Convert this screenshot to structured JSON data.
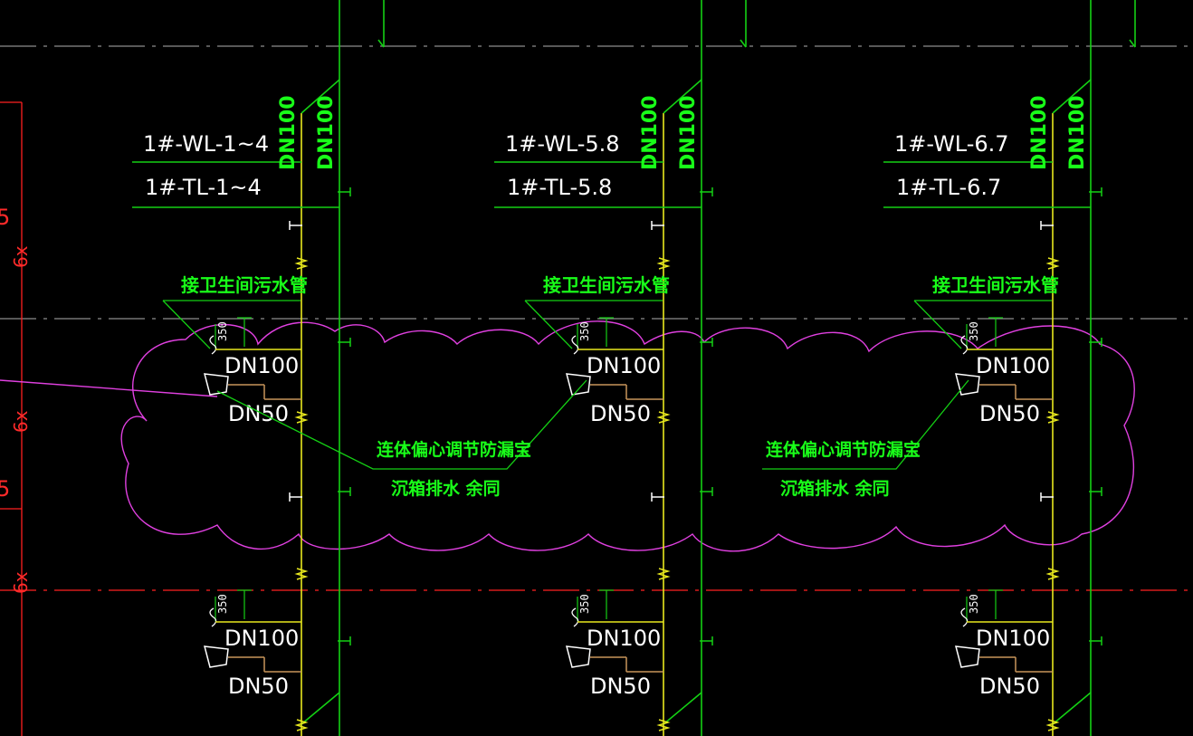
{
  "colors": {
    "background": "#000000",
    "pipe_green": "#14d014",
    "pipe_yellow": "#e8e81e",
    "branch_tan": "#c8965a",
    "text_white": "#ffffff",
    "text_green": "#19ff19",
    "cloud_magenta": "#e040e0",
    "axis_red": "#ff2020",
    "dash_gray": "#8c8c8c"
  },
  "columns": [
    {
      "wl_label": "1#-WL-1~4",
      "tl_label": "1#-TL-1~4",
      "riser_size_1": "DN100",
      "riser_size_2": "DN100",
      "note_label": "接卫生间污水管",
      "upper_fixture": {
        "height_label": "350",
        "pipe_label": "DN100",
        "drain_label": "DN50"
      },
      "lower_fixture": {
        "height_label": "350",
        "pipe_label": "DN100",
        "drain_label": "DN50"
      }
    },
    {
      "wl_label": "1#-WL-5.8",
      "tl_label": "1#-TL-5.8",
      "riser_size_1": "DN100",
      "riser_size_2": "DN100",
      "note_label": "接卫生间污水管",
      "upper_fixture": {
        "height_label": "350",
        "pipe_label": "DN100",
        "drain_label": "DN50"
      },
      "lower_fixture": {
        "height_label": "350",
        "pipe_label": "DN100",
        "drain_label": "DN50"
      }
    },
    {
      "wl_label": "1#-WL-6.7",
      "tl_label": "1#-TL-6.7",
      "riser_size_1": "DN100",
      "riser_size_2": "DN100",
      "note_label": "接卫生间污水管",
      "upper_fixture": {
        "height_label": "350",
        "pipe_label": "DN100",
        "drain_label": "DN50"
      },
      "lower_fixture": {
        "height_label": "350",
        "pipe_label": "DN100",
        "drain_label": "DN50"
      }
    }
  ],
  "callouts": [
    {
      "line1": "连体偏心调节防漏宝",
      "line2": "沉箱排水 余同"
    },
    {
      "line1": "连体偏心调节防漏宝",
      "line2": "沉箱排水 余同"
    }
  ],
  "left_dims": [
    "5",
    "6x",
    "6x",
    "5",
    "6x"
  ]
}
